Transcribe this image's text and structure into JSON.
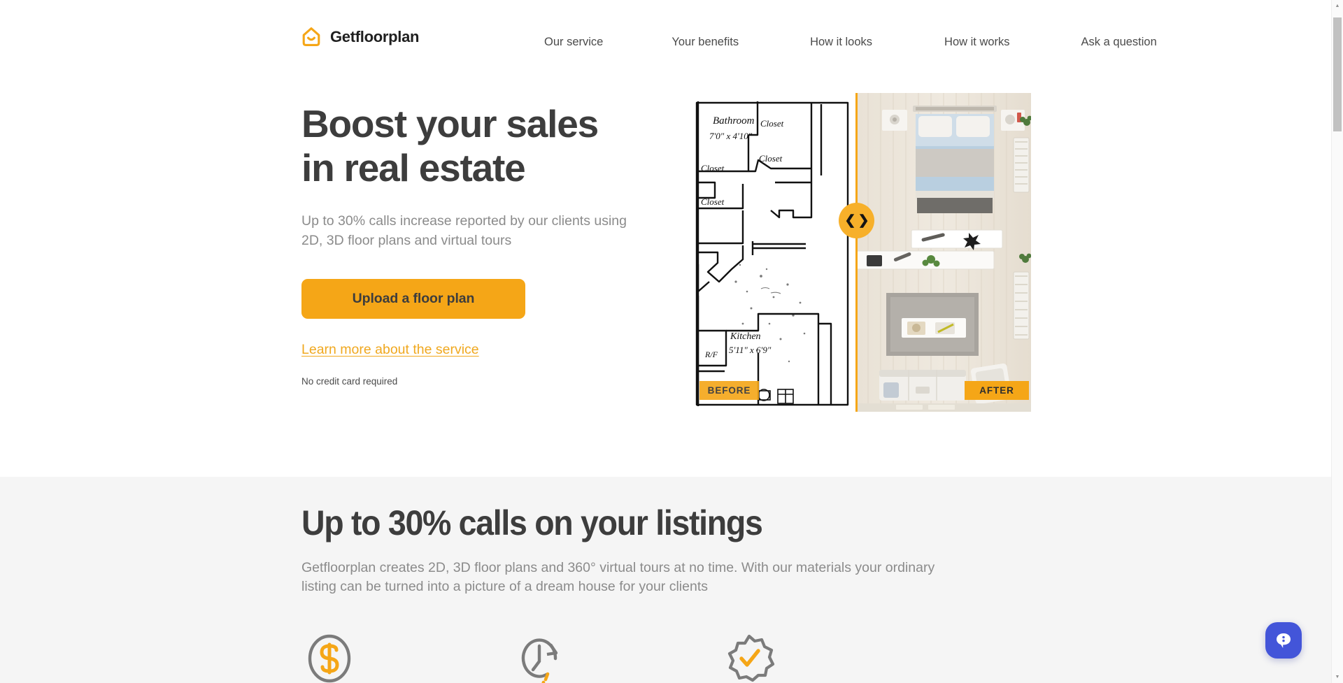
{
  "header": {
    "brand_name": "Getfloorplan",
    "logo_icon": "house-smile-icon",
    "nav": [
      {
        "label": "Our service"
      },
      {
        "label": "Your benefits"
      },
      {
        "label": "How it looks"
      },
      {
        "label": "How it works"
      },
      {
        "label": "Ask a question"
      }
    ]
  },
  "hero": {
    "title_line1": "Boost your sales",
    "title_line2": "in real estate",
    "subtitle": "Up to 30% calls increase reported by our clients using 2D, 3D floor plans and virtual tours",
    "cta_label": "Upload a floor plan",
    "learn_more_label": "Learn more about the service",
    "fineprint": "No credit card required",
    "media": {
      "before_badge": "BEFORE",
      "after_badge": "AFTER",
      "handle_icon": "left-right-chevrons-icon",
      "handle_glyph": "❮ ❯",
      "before_plan_labels": [
        "Bathroom",
        "7'0\" x 4'10\"",
        "Closet",
        "Closet",
        "Closet",
        "Closet",
        "Kitchen",
        "5'11\" x 6'9\"",
        "R/F"
      ]
    }
  },
  "section2": {
    "title": "Up to 30% calls on your listings",
    "body": "Getfloorplan creates 2D, 3D floor plans and 360° virtual tours at no time. With our materials your ordinary listing can be turned into a picture of a dream house for your clients",
    "features": [
      {
        "icon": "dollar-circle-icon"
      },
      {
        "icon": "clock-arrow-icon"
      },
      {
        "icon": "badge-check-icon"
      }
    ]
  },
  "chat": {
    "icon": "chat-bubble-icon"
  },
  "scrollbar": {
    "up_glyph": "▲",
    "down_glyph": "▼"
  },
  "colors": {
    "accent": "#f5a617",
    "accent_light": "#f7b02a",
    "heading": "#3d3d3d",
    "muted_text": "#8b8b8b",
    "nav_text": "#4a4a4a",
    "section_bg": "#f5f5f5",
    "chat_blue": "#4355d9"
  }
}
